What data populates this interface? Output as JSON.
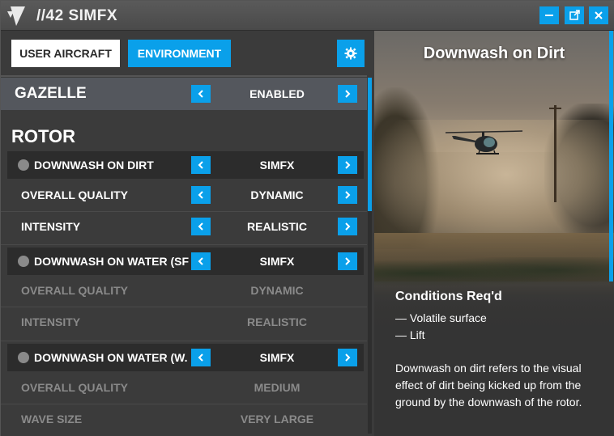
{
  "window": {
    "title": "//42 SIMFX",
    "buttons": [
      "minimize",
      "popout",
      "close"
    ]
  },
  "tabs": {
    "user_aircraft": "USER AIRCRAFT",
    "environment": "ENVIRONMENT",
    "active": "environment"
  },
  "aircraft": {
    "name": "GAZELLE",
    "value": "ENABLED"
  },
  "section": {
    "title": "ROTOR"
  },
  "effects": [
    {
      "name": "DOWNWASH ON DIRT",
      "value": "SIMFX",
      "options": [
        {
          "label": "OVERALL QUALITY",
          "value": "DYNAMIC",
          "enabled": true
        },
        {
          "label": "INTENSITY",
          "value": "REALISTIC",
          "enabled": true
        }
      ]
    },
    {
      "name": "DOWNWASH ON WATER (SF",
      "value": "SIMFX",
      "options": [
        {
          "label": "OVERALL QUALITY",
          "value": "DYNAMIC",
          "enabled": false
        },
        {
          "label": "INTENSITY",
          "value": "REALISTIC",
          "enabled": false
        }
      ]
    },
    {
      "name": "DOWNWASH ON WATER (W.",
      "value": "SIMFX",
      "options": [
        {
          "label": "OVERALL QUALITY",
          "value": "MEDIUM",
          "enabled": false
        },
        {
          "label": "WAVE SIZE",
          "value": "VERY LARGE",
          "enabled": false
        }
      ]
    }
  ],
  "preview": {
    "title": "Downwash on Dirt",
    "conditions_title": "Conditions Req'd",
    "conditions": [
      "— Volatile surface",
      "— Lift"
    ],
    "description": "Downwash on dirt refers to the visual effect of dirt being kicked up from the ground by the downwash of the rotor."
  },
  "colors": {
    "accent": "#0aa0ea",
    "panel": "#3b3b3b",
    "disabled_text": "#8a8a8a"
  },
  "icons": {
    "title": "simfx-logo-icon",
    "settings": "gear-icon",
    "left": "chevron-left-icon",
    "right": "chevron-right-icon"
  }
}
